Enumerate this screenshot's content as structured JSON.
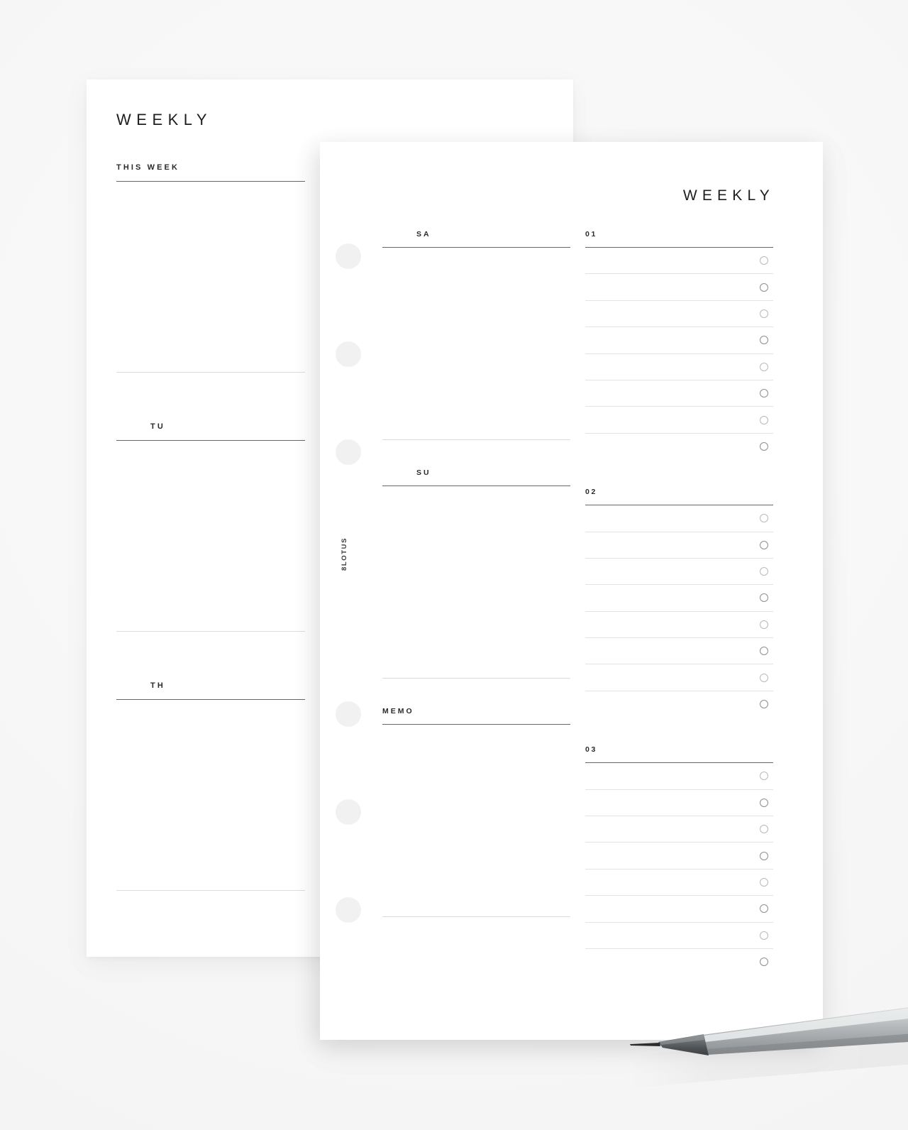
{
  "background_color": "#f7f7f7",
  "scene": {
    "objects": [
      "left-planner-page",
      "right-planner-page",
      "mechanical-pencil"
    ]
  },
  "left_page": {
    "title": "WEEKLY",
    "sections": [
      {
        "label": "THIS WEEK",
        "align": "left"
      },
      {
        "label": "TU",
        "align": "indent"
      },
      {
        "label": "TH",
        "align": "indent"
      }
    ]
  },
  "right_page": {
    "title": "WEEKLY",
    "brand": "8LOTUS",
    "punch_holes": 6,
    "notes_sections": [
      {
        "label": "SA",
        "align": "indent"
      },
      {
        "label": "SU",
        "align": "indent"
      },
      {
        "label": "MEMO",
        "align": "left"
      }
    ],
    "task_sections": [
      {
        "label": "01",
        "rows": 8
      },
      {
        "label": "02",
        "rows": 8
      },
      {
        "label": "03",
        "rows": 8
      }
    ]
  },
  "pencil": {
    "body_color": "#b9bcbd",
    "tip_color": "#5e6163",
    "lead_color": "#2b2d2e"
  },
  "colors": {
    "paper": "#ffffff",
    "rule_strong": "#666666",
    "rule_faint": "#dcdcdc",
    "row_rule": "#e3e3e3",
    "text": "#1e1e1e",
    "punch": "#f1f1f1",
    "checkbox_light": "#b9b9b9",
    "checkbox_dark": "#8e8e8e"
  }
}
